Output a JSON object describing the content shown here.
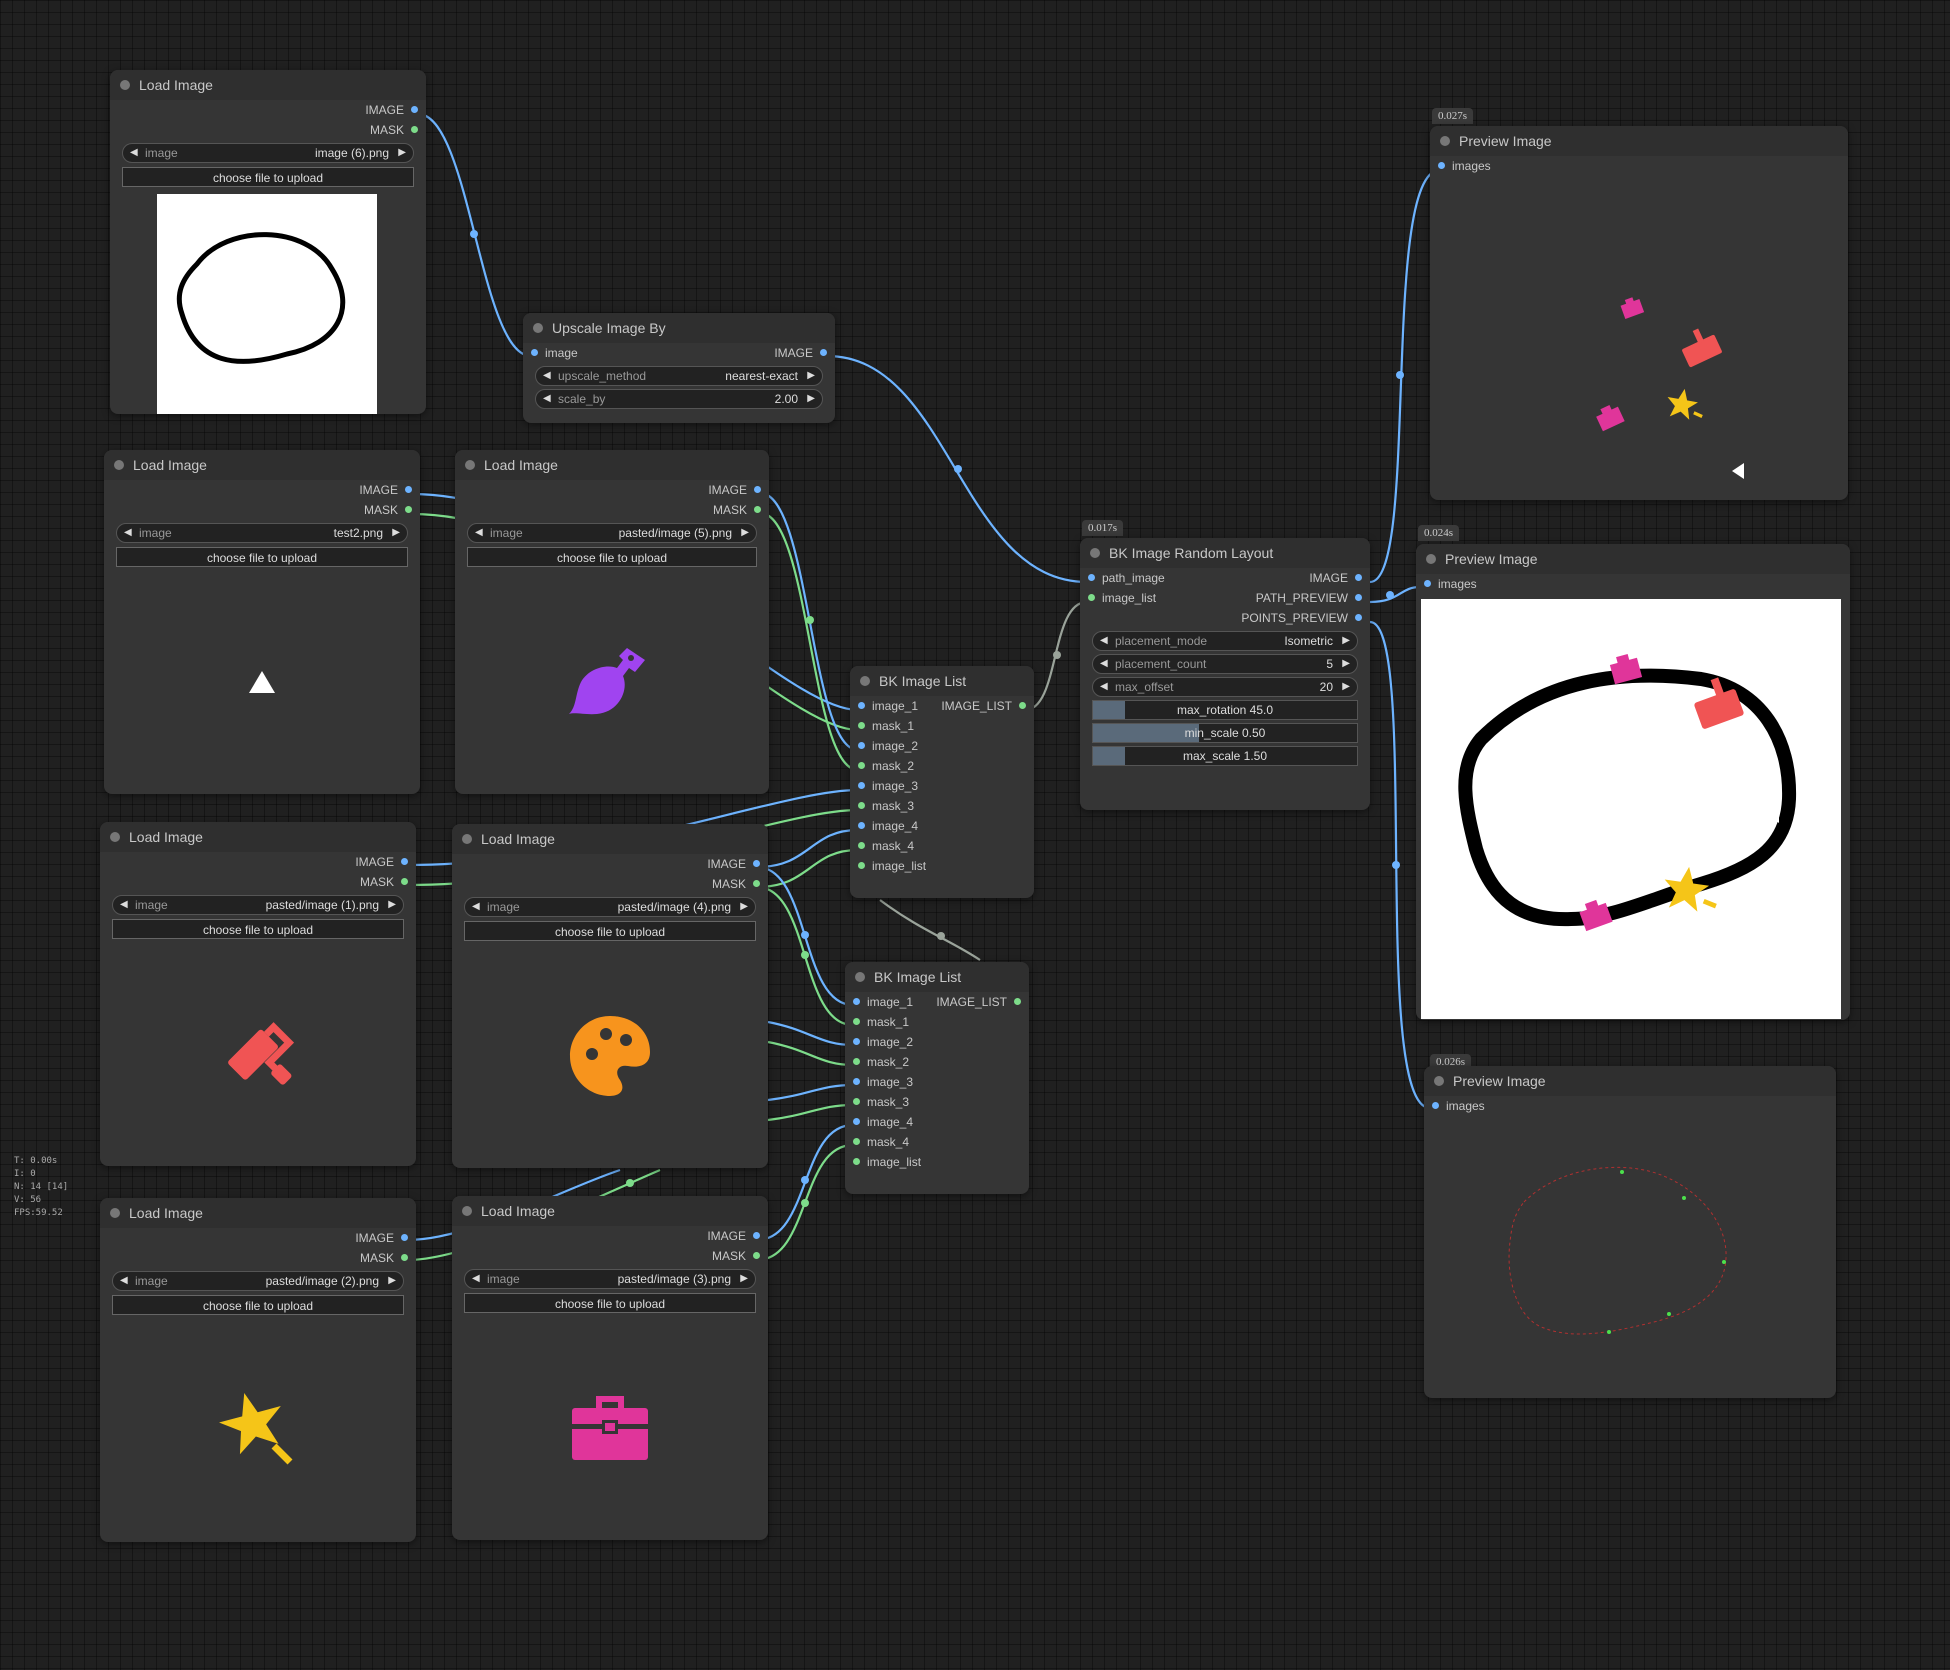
{
  "nodes": {
    "load1": {
      "title": "Load Image",
      "out1": "IMAGE",
      "out2": "MASK",
      "widget_name": "image",
      "widget_value": "image (6).png",
      "upload": "choose file to upload"
    },
    "load2": {
      "title": "Load Image",
      "out1": "IMAGE",
      "out2": "MASK",
      "widget_name": "image",
      "widget_value": "test2.png",
      "upload": "choose file to upload"
    },
    "load3": {
      "title": "Load Image",
      "out1": "IMAGE",
      "out2": "MASK",
      "widget_name": "image",
      "widget_value": "pasted/image (5).png",
      "upload": "choose file to upload"
    },
    "load4": {
      "title": "Load Image",
      "out1": "IMAGE",
      "out2": "MASK",
      "widget_name": "image",
      "widget_value": "pasted/image (1).png",
      "upload": "choose file to upload"
    },
    "load5": {
      "title": "Load Image",
      "out1": "IMAGE",
      "out2": "MASK",
      "widget_name": "image",
      "widget_value": "pasted/image (4).png",
      "upload": "choose file to upload"
    },
    "load6": {
      "title": "Load Image",
      "out1": "IMAGE",
      "out2": "MASK",
      "widget_name": "image",
      "widget_value": "pasted/image (2).png",
      "upload": "choose file to upload"
    },
    "load7": {
      "title": "Load Image",
      "out1": "IMAGE",
      "out2": "MASK",
      "widget_name": "image",
      "widget_value": "pasted/image (3).png",
      "upload": "choose file to upload"
    },
    "upscale": {
      "title": "Upscale Image By",
      "in1": "image",
      "out1": "IMAGE",
      "w1_name": "upscale_method",
      "w1_value": "nearest-exact",
      "w2_name": "scale_by",
      "w2_value": "2.00"
    },
    "list1": {
      "title": "BK Image List",
      "output": "IMAGE_LIST",
      "inputs": [
        "image_1",
        "mask_1",
        "image_2",
        "mask_2",
        "image_3",
        "mask_3",
        "image_4",
        "mask_4",
        "image_list"
      ]
    },
    "list2": {
      "title": "BK Image List",
      "output": "IMAGE_LIST",
      "inputs": [
        "image_1",
        "mask_1",
        "image_2",
        "mask_2",
        "image_3",
        "mask_3",
        "image_4",
        "mask_4",
        "image_list"
      ]
    },
    "layout": {
      "timing": "0.017s",
      "title": "BK Image Random Layout",
      "in1": "path_image",
      "in2": "image_list",
      "out1": "IMAGE",
      "out2": "PATH_PREVIEW",
      "out3": "POINTS_PREVIEW",
      "w1_name": "placement_mode",
      "w1_value": "Isometric",
      "w2_name": "placement_count",
      "w2_value": "5",
      "w3_name": "max_offset",
      "w3_value": "20",
      "s1": "max_rotation  45.0",
      "s2": "min_scale  0.50",
      "s3": "max_scale  1.50"
    },
    "preview1": {
      "timing": "0.027s",
      "title": "Preview Image",
      "in1": "images"
    },
    "preview2": {
      "timing": "0.024s",
      "title": "Preview Image",
      "in1": "images"
    },
    "preview3": {
      "timing": "0.026s",
      "title": "Preview Image",
      "in1": "images"
    }
  },
  "stats": {
    "t": "T: 0.00s",
    "i": "I: 0",
    "n": "N: 14 [14]",
    "v": "V: 56",
    "fps": "FPS:59.52"
  },
  "colors": {
    "image_link": "#6db3ff",
    "mask_link": "#7ddc8a",
    "list_link": "#9aa39a",
    "red": "#f05454",
    "pink": "#e0359a",
    "purple": "#a044f0",
    "orange": "#f7941d",
    "yellow": "#f5c518"
  },
  "icons": {
    "load2": "triangle-icon",
    "load3": "brush-icon",
    "load4": "paint-roller-icon",
    "load5": "palette-icon",
    "load6": "magic-star-icon",
    "load7": "toolbox-icon"
  }
}
